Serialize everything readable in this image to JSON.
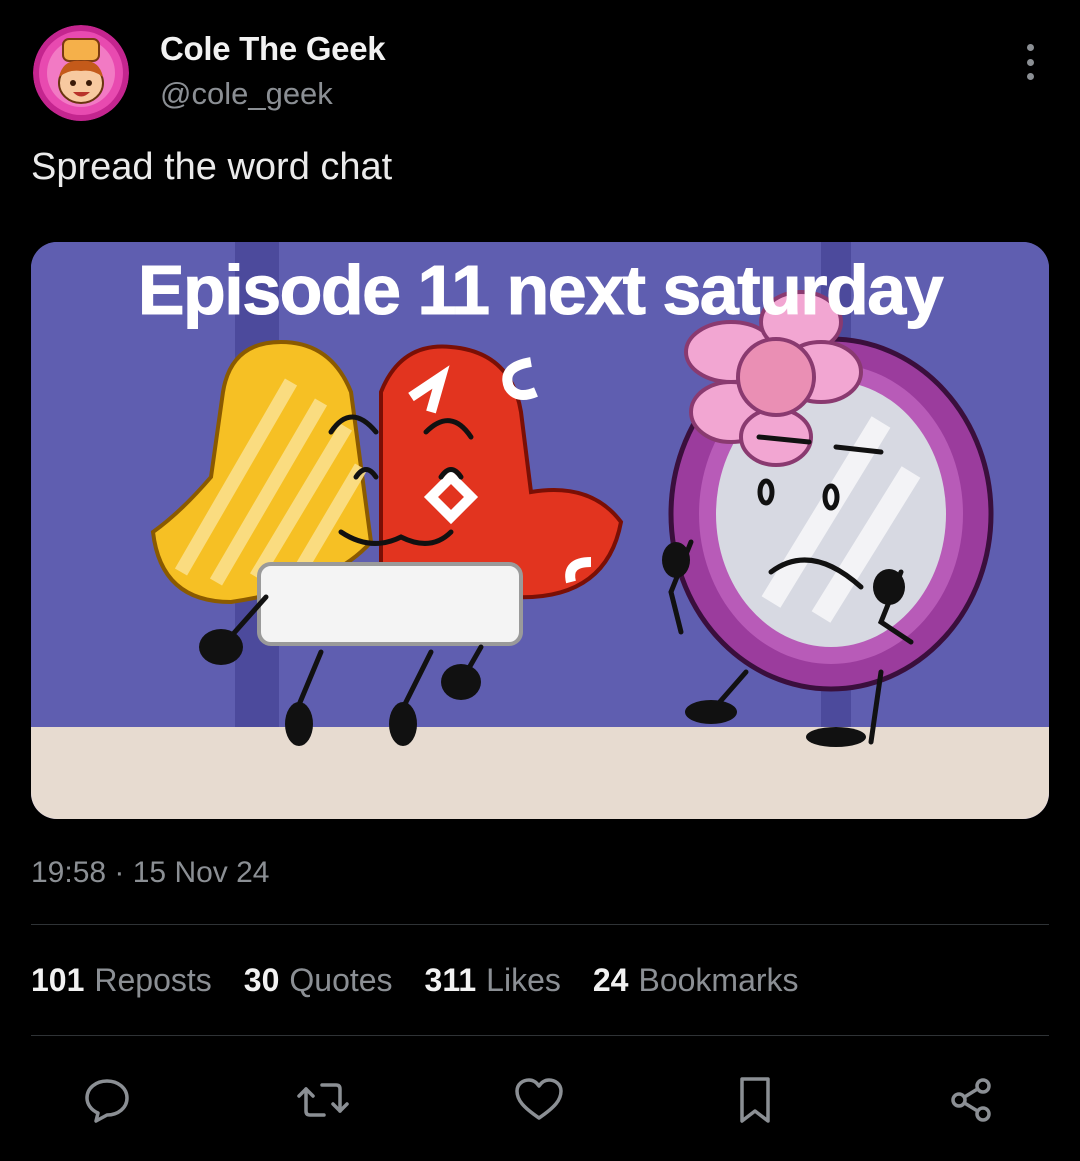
{
  "author": {
    "display_name": "Cole The Geek",
    "handle": "@cole_geek"
  },
  "tweet": {
    "text": "Spread the word chat",
    "media_title": "Episode 11 next saturday",
    "timestamp": "19:58 · 15 Nov 24"
  },
  "stats": [
    {
      "count": "101",
      "label": "Reposts"
    },
    {
      "count": "30",
      "label": "Quotes"
    },
    {
      "count": "311",
      "label": "Likes"
    },
    {
      "count": "24",
      "label": "Bookmarks"
    }
  ],
  "actions": [
    "reply-icon",
    "repost-icon",
    "like-icon",
    "bookmark-icon",
    "share-icon"
  ],
  "colors": {
    "background": "#000000",
    "muted_text": "#8b8f94",
    "divider": "#2f3336",
    "media_bg": "#5f5eb0",
    "media_floor": "#e7dbd0"
  }
}
